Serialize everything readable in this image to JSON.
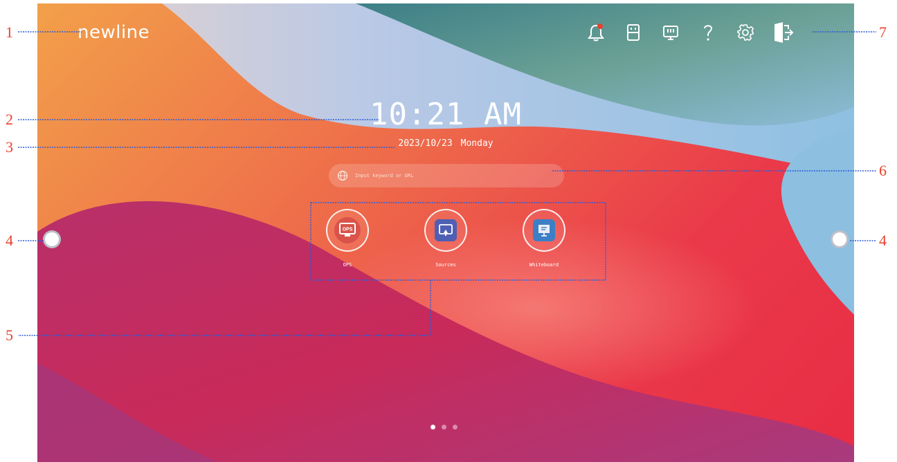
{
  "logo": "newline",
  "topbar": [
    {
      "name": "notification-bell-icon"
    },
    {
      "name": "usb-drive-icon"
    },
    {
      "name": "screen-cast-icon"
    },
    {
      "name": "help-icon"
    },
    {
      "name": "settings-gear-icon"
    },
    {
      "name": "exit-icon"
    }
  ],
  "clock": {
    "time": "10:21 AM"
  },
  "date": {
    "date": "2023/10/23",
    "weekday": "Monday"
  },
  "search": {
    "placeholder": "Input keyword or URL"
  },
  "apps": [
    {
      "label": "OPS",
      "icon": "ops-icon",
      "badge": "OPS"
    },
    {
      "label": "Sources",
      "icon": "sources-icon"
    },
    {
      "label": "Whiteboard",
      "icon": "whiteboard-icon"
    }
  ],
  "pages": {
    "count": 3,
    "active": 1
  },
  "callouts": [
    "1",
    "2",
    "3",
    "4",
    "4",
    "5",
    "6",
    "7"
  ],
  "colors": {
    "callout": "#e8402e",
    "leader": "#2a5bd7",
    "notification": "#e8402e"
  }
}
